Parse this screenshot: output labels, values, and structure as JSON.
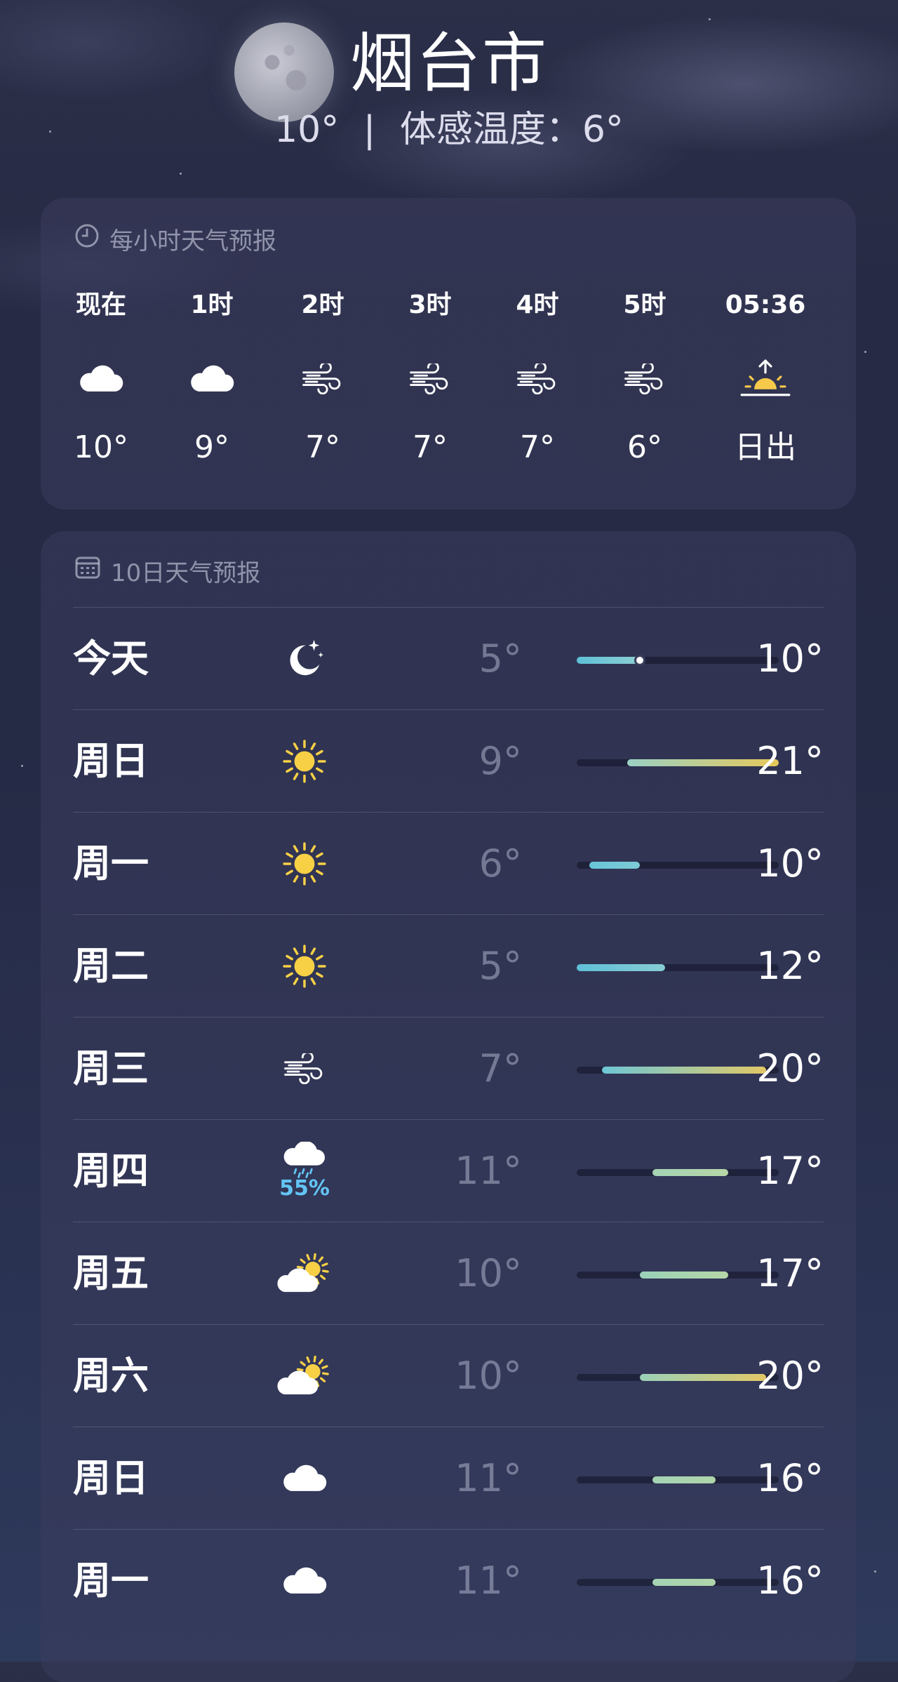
{
  "header": {
    "city": "烟台市",
    "current_temp": "10°",
    "separator": "|",
    "feels_like": "体感温度：6°"
  },
  "hourly": {
    "title": "每小时天气预报",
    "icon": "clock-icon",
    "items": [
      {
        "label": "现在",
        "icon": "cloud-icon",
        "temp": "10°"
      },
      {
        "label": "1时",
        "icon": "cloud-icon",
        "temp": "9°"
      },
      {
        "label": "2时",
        "icon": "wind-icon",
        "temp": "7°"
      },
      {
        "label": "3时",
        "icon": "wind-icon",
        "temp": "7°"
      },
      {
        "label": "4时",
        "icon": "wind-icon",
        "temp": "7°"
      },
      {
        "label": "5时",
        "icon": "wind-icon",
        "temp": "6°"
      },
      {
        "label": "05:36",
        "icon": "sunrise-icon",
        "temp": "日出"
      }
    ]
  },
  "daily": {
    "title": "10日天气预报",
    "icon": "calendar-icon",
    "range_min": 5,
    "range_max": 21,
    "current_temp_value": 10,
    "items": [
      {
        "day": "今天",
        "icon": "moon-icon",
        "precip": "",
        "low": "5°",
        "high": "10°",
        "low_value": 5,
        "high_value": 10,
        "colors": [
          "#5fc0d8",
          "#8ccfd2"
        ],
        "show_now": true
      },
      {
        "day": "周日",
        "icon": "sun-icon",
        "precip": "",
        "low": "9°",
        "high": "21°",
        "low_value": 9,
        "high_value": 21,
        "colors": [
          "#9bd1c4",
          "#e6c85a"
        ],
        "show_now": false
      },
      {
        "day": "周一",
        "icon": "sun-icon",
        "precip": "",
        "low": "6°",
        "high": "10°",
        "low_value": 6,
        "high_value": 10,
        "colors": [
          "#67c5d8",
          "#7ecad6"
        ],
        "show_now": false
      },
      {
        "day": "周二",
        "icon": "sun-icon",
        "precip": "",
        "low": "5°",
        "high": "12°",
        "low_value": 5,
        "high_value": 12,
        "colors": [
          "#5fc0d8",
          "#86ccd4"
        ],
        "show_now": false
      },
      {
        "day": "周三",
        "icon": "wind-icon",
        "precip": "",
        "low": "7°",
        "high": "20°",
        "low_value": 7,
        "high_value": 20,
        "colors": [
          "#6ec7d6",
          "#e2c867"
        ],
        "show_now": false
      },
      {
        "day": "周四",
        "icon": "cloud-rain-icon",
        "precip": "55%",
        "low": "11°",
        "high": "17°",
        "low_value": 11,
        "high_value": 17,
        "colors": [
          "#a4d3b4",
          "#b6d6a7"
        ],
        "show_now": false
      },
      {
        "day": "周五",
        "icon": "partly-cloudy-icon",
        "precip": "",
        "low": "10°",
        "high": "17°",
        "low_value": 10,
        "high_value": 17,
        "colors": [
          "#9ad2b8",
          "#b6d6a7"
        ],
        "show_now": false
      },
      {
        "day": "周六",
        "icon": "partly-cloudy-icon",
        "precip": "",
        "low": "10°",
        "high": "20°",
        "low_value": 10,
        "high_value": 20,
        "colors": [
          "#9ad2b8",
          "#e2c867"
        ],
        "show_now": false
      },
      {
        "day": "周日",
        "icon": "cloud-icon",
        "precip": "",
        "low": "11°",
        "high": "16°",
        "low_value": 11,
        "high_value": 16,
        "colors": [
          "#a4d3b4",
          "#b0d5aa"
        ],
        "show_now": false
      },
      {
        "day": "周一",
        "icon": "cloud-icon",
        "precip": "",
        "low": "11°",
        "high": "16°",
        "low_value": 11,
        "high_value": 16,
        "colors": [
          "#a4d3b4",
          "#b0d5aa"
        ],
        "show_now": false
      }
    ]
  }
}
